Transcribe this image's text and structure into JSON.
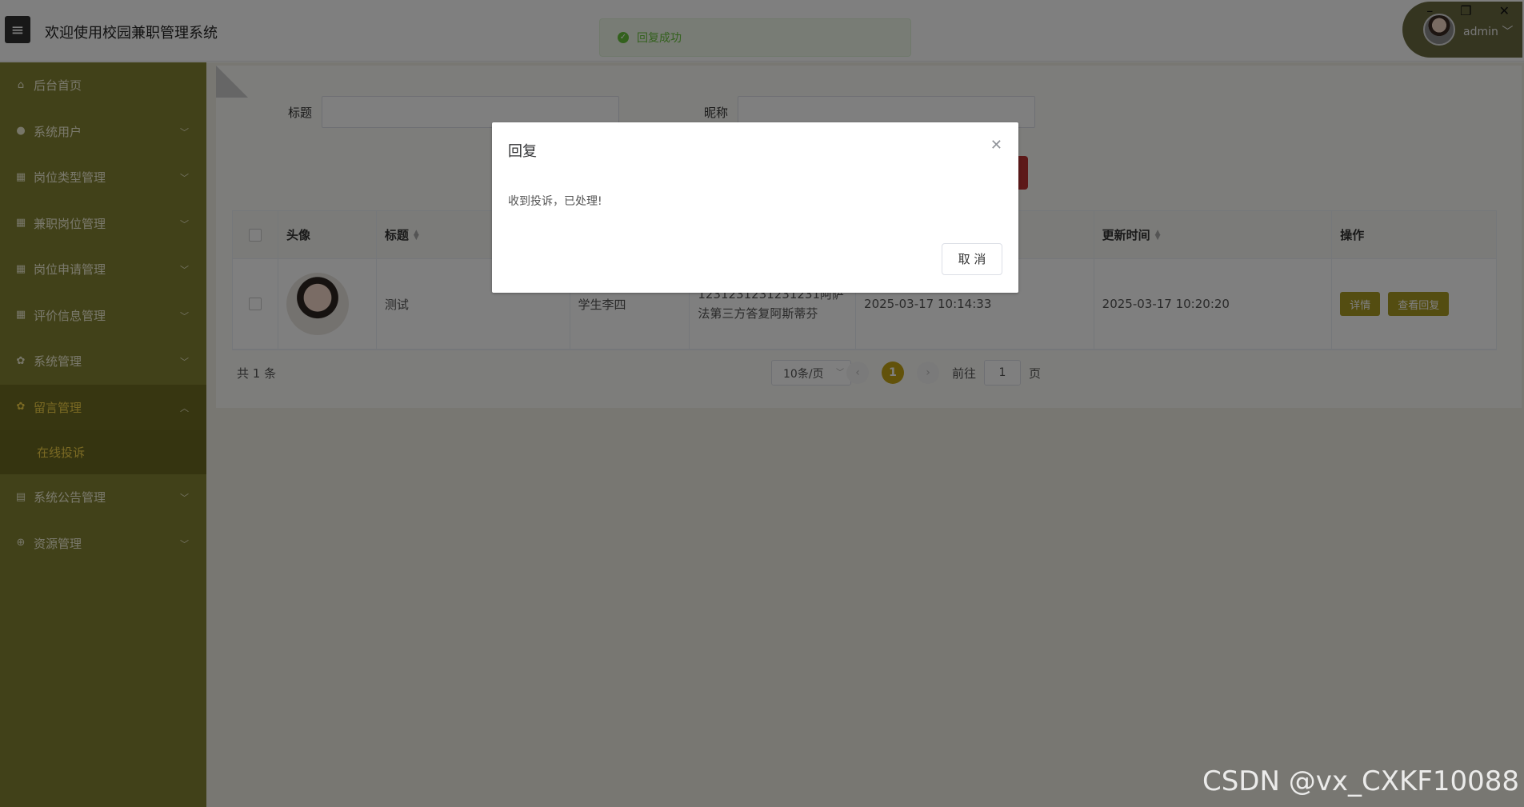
{
  "header": {
    "menu_icon": "menu-icon",
    "title": "欢迎使用校园兼职管理系统",
    "toast": "回复成功",
    "user": "admin ﹀"
  },
  "sidebar": {
    "items": [
      {
        "label": "后台首页",
        "icon": "home-icon",
        "glyph": "⌂"
      },
      {
        "label": "系统用户",
        "icon": "user-icon",
        "glyph": "●"
      },
      {
        "label": "岗位类型管理",
        "icon": "grid-icon",
        "glyph": "▦"
      },
      {
        "label": "兼职岗位管理",
        "icon": "grid-icon",
        "glyph": "▦"
      },
      {
        "label": "岗位申请管理",
        "icon": "grid-icon",
        "glyph": "▦"
      },
      {
        "label": "评价信息管理",
        "icon": "grid-icon",
        "glyph": "▦"
      },
      {
        "label": "系统管理",
        "icon": "gear-icon",
        "glyph": "✿"
      },
      {
        "label": "留言管理",
        "icon": "gear-icon",
        "glyph": "✿"
      },
      {
        "label": "系统公告管理",
        "icon": "document-icon",
        "glyph": "▤"
      },
      {
        "label": "资源管理",
        "icon": "plus-circle-icon",
        "glyph": "⊕"
      }
    ],
    "sub_item": "在线投诉"
  },
  "filters": {
    "title_label": "标题",
    "nickname_label": "昵称"
  },
  "table": {
    "headers": [
      "头像",
      "标题",
      "更新时间",
      "操作"
    ],
    "row": {
      "title": "测试",
      "user": "学生李四",
      "reply": "1231231231231231阿萨法第三方答复阿斯蒂芬",
      "created": "2025-03-17 10:14:33",
      "updated": "2025-03-17 10:20:20",
      "detail_btn": "详情",
      "reply_btn": "查看回复"
    }
  },
  "pager": {
    "total": "共 1 条",
    "page_size": "10条/页",
    "current": "1",
    "goto_prefix": "前往",
    "goto_value": "1",
    "goto_suffix": "页"
  },
  "dialog": {
    "title": "回复",
    "body": "收到投诉，已处理!",
    "cancel": "取 消"
  },
  "watermark": "CSDN @vx_CXKF10088",
  "colors": {
    "sidebar": "#838232",
    "accent": "#c4a515",
    "button": "#a89a22"
  }
}
